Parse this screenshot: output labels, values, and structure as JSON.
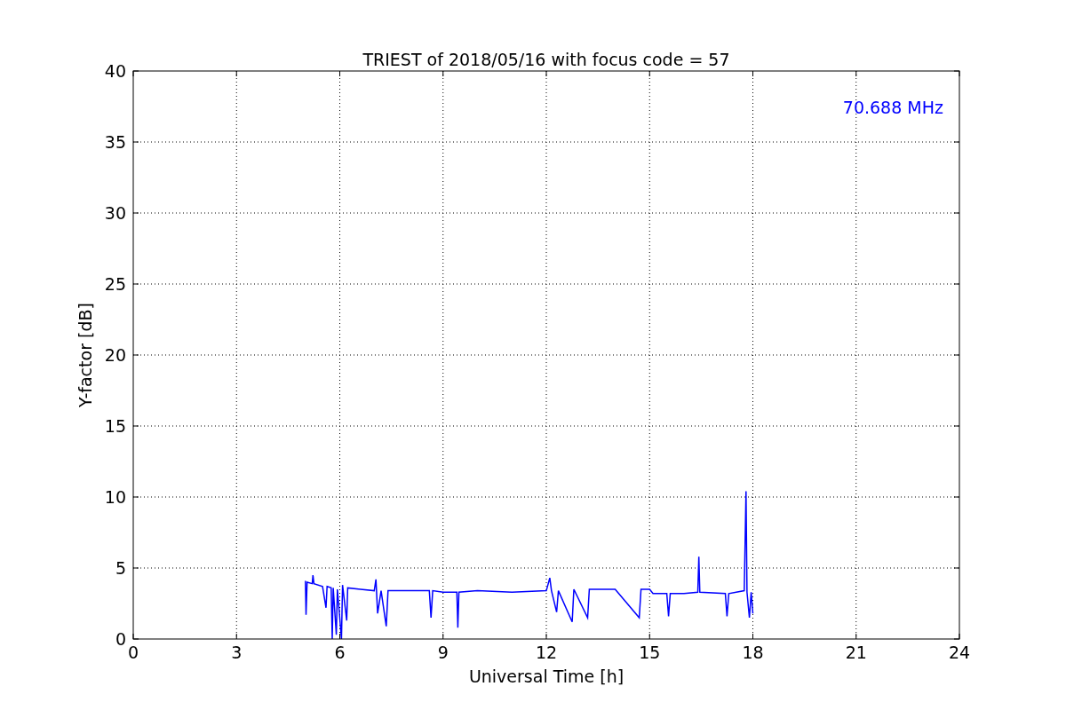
{
  "figure": {
    "chart_data": {
      "type": "line",
      "title": "TRIEST of 2018/05/16 with focus code = 57",
      "xlabel": "Universal Time [h]",
      "ylabel": "Y-factor [dB]",
      "x": [
        5.0,
        5.02,
        5.05,
        5.2,
        5.22,
        5.25,
        5.5,
        5.6,
        5.63,
        5.75,
        5.78,
        5.81,
        5.9,
        5.93,
        6.05,
        6.08,
        6.2,
        6.23,
        6.6,
        7.0,
        7.05,
        7.1,
        7.2,
        7.35,
        7.4,
        8.0,
        8.6,
        8.65,
        8.7,
        9.0,
        9.4,
        9.43,
        9.46,
        10.0,
        11.0,
        12.0,
        12.1,
        12.15,
        12.3,
        12.35,
        12.75,
        12.8,
        13.2,
        13.25,
        14.0,
        14.7,
        14.75,
        15.0,
        15.1,
        15.5,
        15.55,
        15.6,
        16.0,
        16.4,
        16.43,
        16.46,
        17.2,
        17.25,
        17.3,
        17.75,
        17.8,
        17.83,
        17.9,
        17.95,
        18.0
      ],
      "series": [
        {
          "name": "70.688 MHz",
          "color": "#0000ff",
          "values": [
            4.1,
            1.7,
            4.0,
            3.9,
            4.5,
            3.9,
            3.7,
            2.2,
            3.7,
            3.6,
            0.0,
            3.6,
            0.3,
            3.5,
            0.0,
            3.8,
            1.3,
            3.6,
            3.5,
            3.4,
            4.2,
            1.8,
            3.4,
            0.9,
            3.4,
            3.4,
            3.4,
            1.5,
            3.4,
            3.3,
            3.3,
            0.8,
            3.3,
            3.4,
            3.3,
            3.4,
            4.3,
            3.4,
            1.9,
            3.4,
            1.2,
            3.5,
            1.5,
            3.5,
            3.5,
            1.5,
            3.5,
            3.5,
            3.2,
            3.2,
            1.6,
            3.2,
            3.2,
            3.3,
            5.8,
            3.3,
            3.2,
            1.6,
            3.2,
            3.4,
            10.4,
            3.3,
            1.5,
            3.3,
            1.8
          ]
        }
      ],
      "xlim": [
        0,
        24
      ],
      "ylim": [
        0,
        40
      ],
      "xticks": [
        0,
        3,
        6,
        9,
        12,
        15,
        18,
        21,
        24
      ],
      "yticks": [
        0,
        5,
        10,
        15,
        20,
        25,
        30,
        35,
        40
      ],
      "grid": true
    }
  }
}
